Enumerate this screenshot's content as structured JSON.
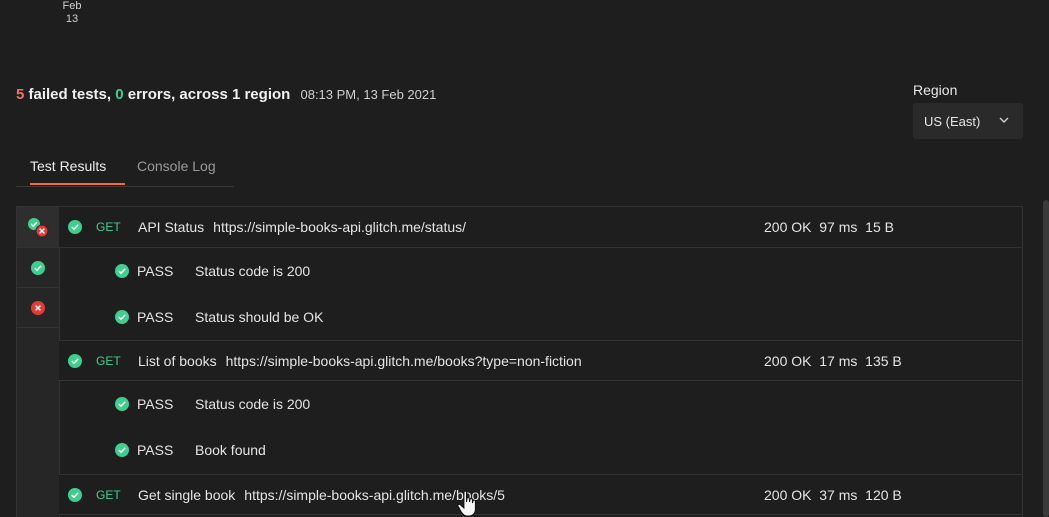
{
  "date_tick": {
    "month": "Feb",
    "day": "13"
  },
  "summary": {
    "failed_count": "5",
    "failed_text": " failed tests, ",
    "error_count": "0",
    "error_text": " errors, across 1 region",
    "timestamp": "08:13 PM, 13 Feb 2021"
  },
  "region": {
    "label": "Region",
    "value": "US (East)"
  },
  "tabs": [
    {
      "label": "Test Results",
      "active": true
    },
    {
      "label": "Console Log",
      "active": false
    }
  ],
  "colors": {
    "accent": "#f26b3a",
    "pass": "#3ecf8e",
    "fail": "#e53935",
    "method": "#3ecf8e"
  },
  "requests": [
    {
      "method": "GET",
      "name": "API Status",
      "url": "https://simple-books-api.glitch.me/status/",
      "status": "200 OK",
      "time": "97 ms",
      "size": "15 B",
      "tests": [
        {
          "result": "PASS",
          "name": "Status code is 200"
        },
        {
          "result": "PASS",
          "name": "Status should be OK"
        }
      ]
    },
    {
      "method": "GET",
      "name": "List of books",
      "url": "https://simple-books-api.glitch.me/books?type=non-fiction",
      "status": "200 OK",
      "time": "17 ms",
      "size": "135 B",
      "tests": [
        {
          "result": "PASS",
          "name": "Status code is 200"
        },
        {
          "result": "PASS",
          "name": "Book found"
        }
      ]
    },
    {
      "method": "GET",
      "name": "Get single book",
      "url": "https://simple-books-api.glitch.me/books/5",
      "status": "200 OK",
      "time": "37 ms",
      "size": "120 B",
      "tests": []
    }
  ],
  "gutter_icons": [
    "pass-fail-icon",
    "pass-icon",
    "fail-icon"
  ]
}
